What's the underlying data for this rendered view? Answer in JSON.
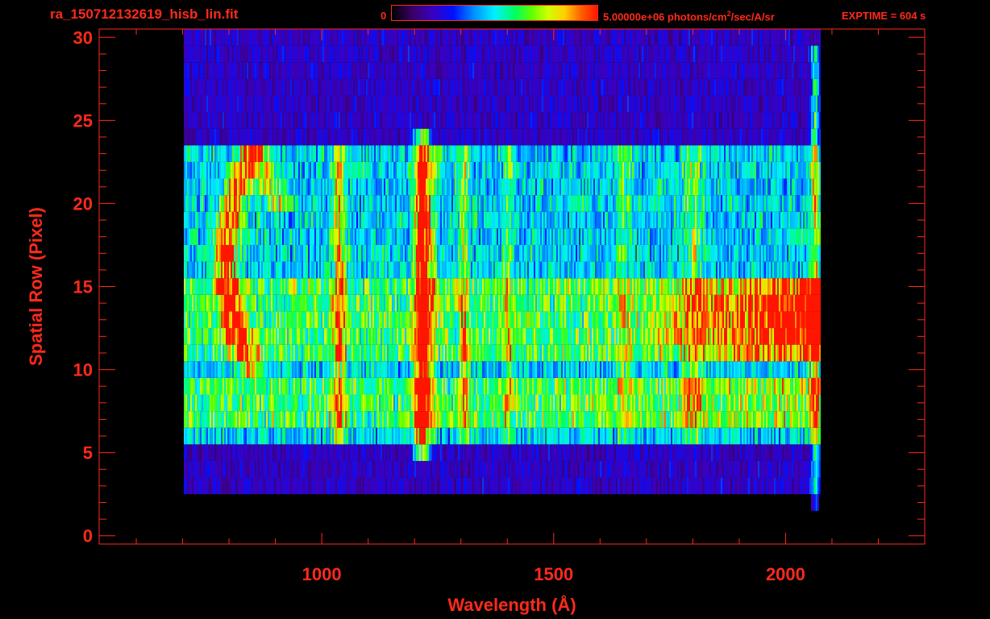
{
  "header": {
    "file_title": "ra_150712132619_hisb_lin.fit",
    "colorbar_min": "0",
    "colorbar_max_value": "5.00000e+06 photons/cm",
    "colorbar_max_exp": "2",
    "colorbar_max_unit": "/sec/A/sr",
    "exptime": "EXPTIME = 604 s"
  },
  "colors": {
    "background": "#000000",
    "axis": "#ff2a1a",
    "text": "#ff2a1a"
  },
  "chart_data": {
    "type": "heatmap",
    "title": "ra_150712132619_hisb_lin.fit",
    "xlabel": "Wavelength (Å)",
    "ylabel": "Spatial Row (Pixel)",
    "xlim": [
      520,
      2300
    ],
    "ylim": [
      -0.5,
      30.5
    ],
    "x_ticks": [
      1000,
      1500,
      2000
    ],
    "y_ticks": [
      0,
      5,
      10,
      15,
      20,
      25,
      30
    ],
    "colorscale": "rainbow",
    "zlim": [
      0,
      5000000
    ],
    "zunit": "photons/cm^2/sec/A/sr",
    "exptime_s": 604,
    "grid": false
  }
}
